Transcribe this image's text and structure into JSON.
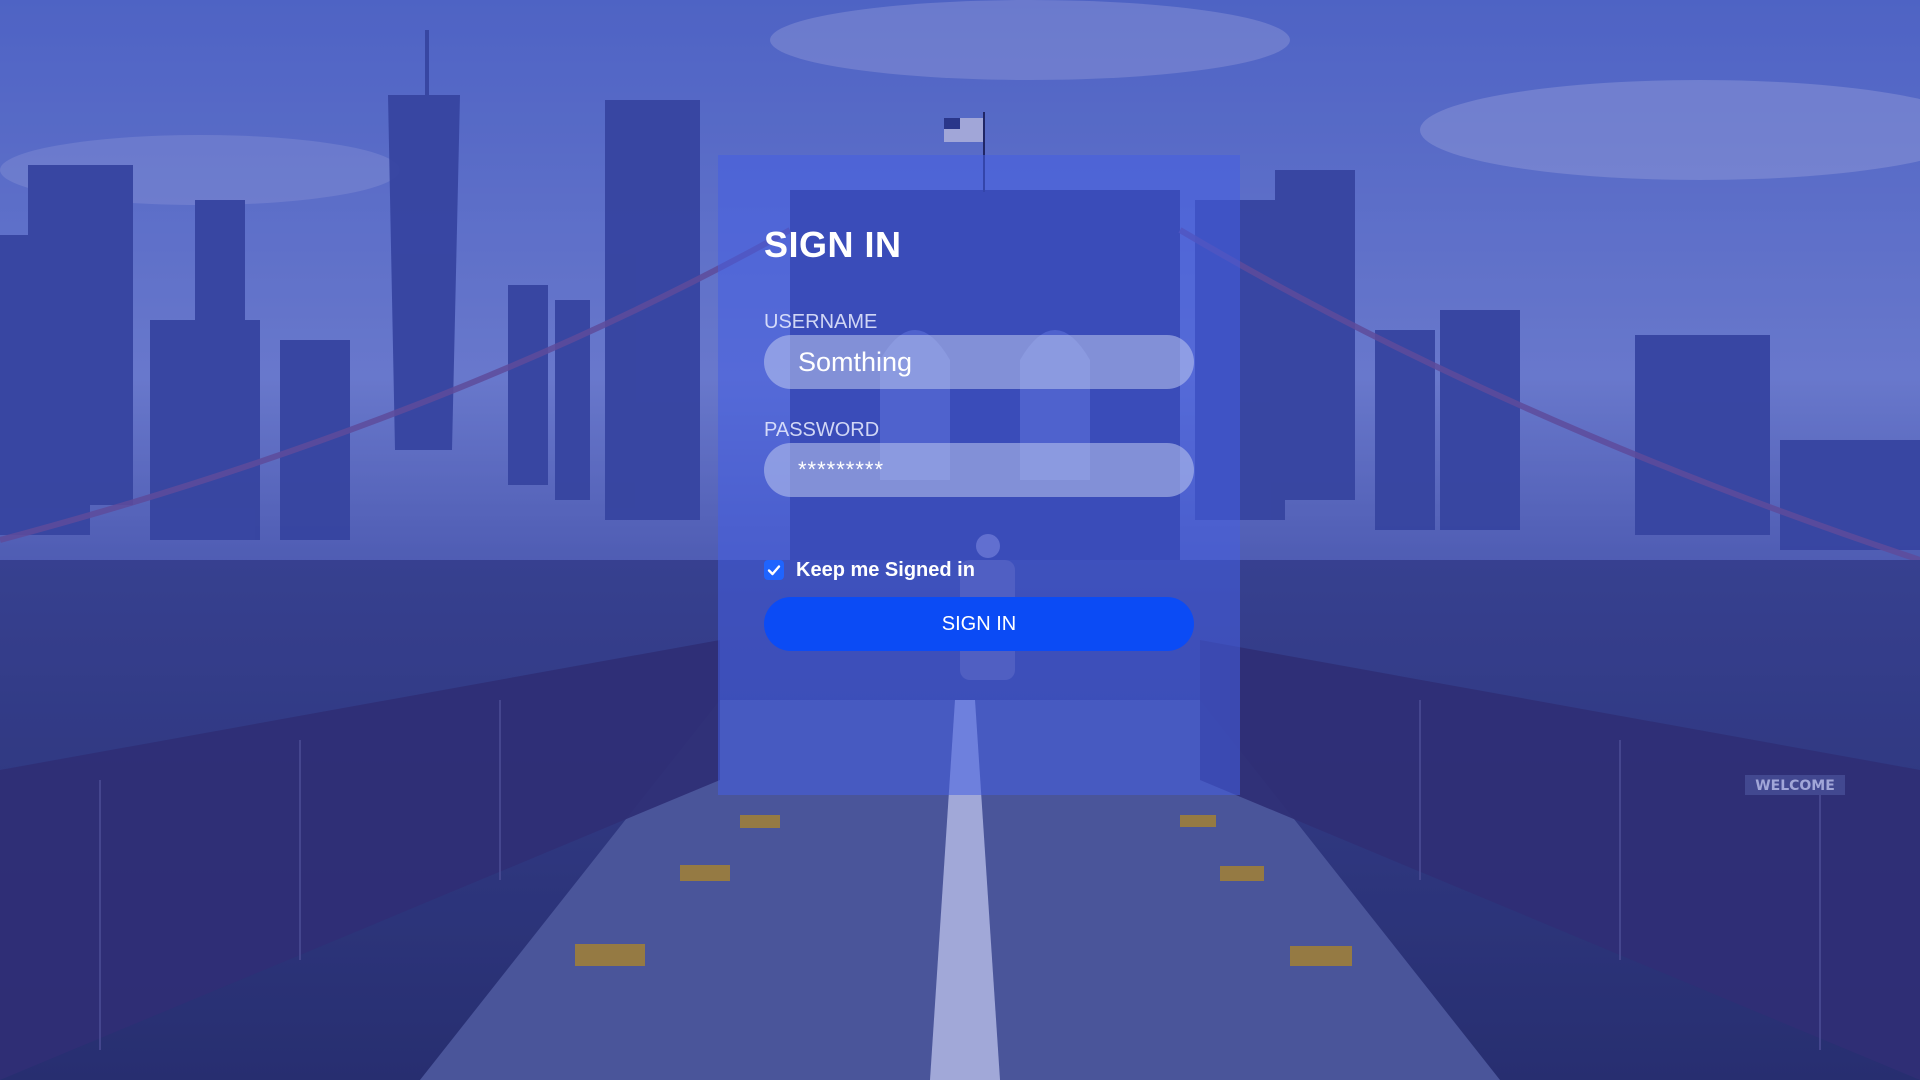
{
  "login": {
    "title": "SIGN IN",
    "username_label": "USERNAME",
    "username_value": "Somthing",
    "password_label": "PASSWORD",
    "password_value": "*********",
    "keep_signed_in_label": "Keep me Signed in",
    "keep_signed_in_checked": true,
    "submit_label": "SIGN IN"
  },
  "colors": {
    "overlay": "#2b3580",
    "accent": "#0b4bf5",
    "panel": "#4660e1"
  },
  "background": {
    "scene": "city skyline bridge photo",
    "sign_text": "WELCOME"
  }
}
